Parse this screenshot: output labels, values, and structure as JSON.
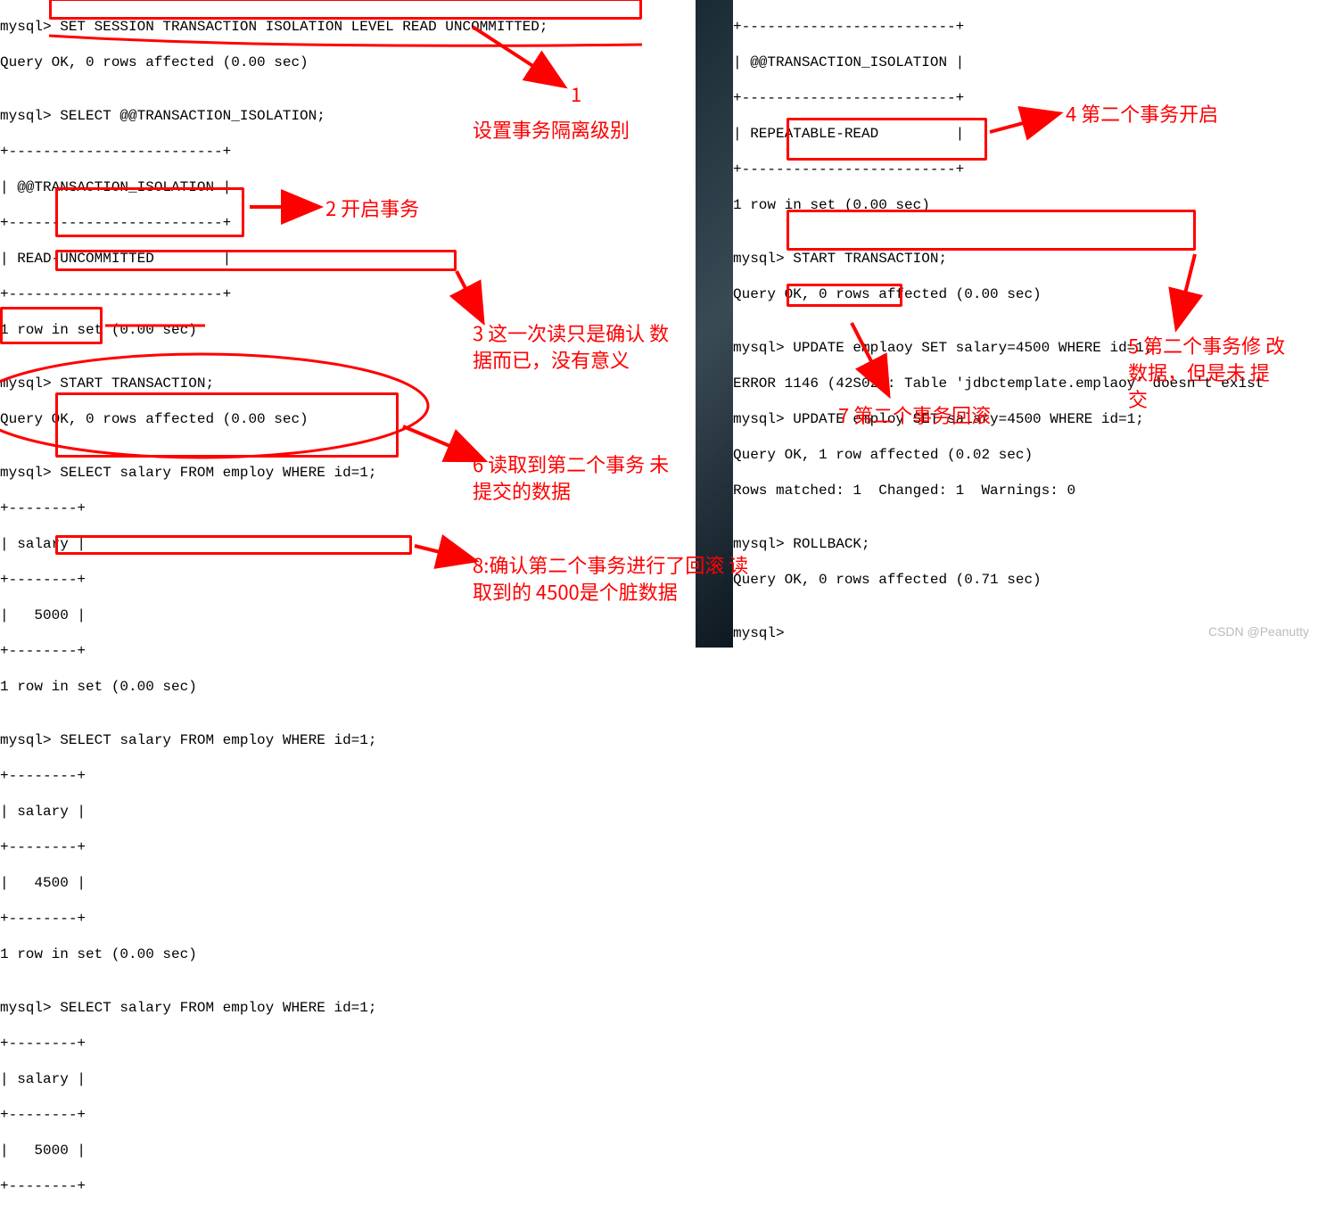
{
  "left_terminal": {
    "lines": [
      "mysql> SET SESSION TRANSACTION ISOLATION LEVEL READ UNCOMMITTED;",
      "Query OK, 0 rows affected (0.00 sec)",
      "",
      "mysql> SELECT @@TRANSACTION_ISOLATION;",
      "+-------------------------+",
      "| @@TRANSACTION_ISOLATION |",
      "+-------------------------+",
      "| READ-UNCOMMITTED        |",
      "+-------------------------+",
      "1 row in set (0.00 sec)",
      "",
      "mysql> START TRANSACTION;",
      "Query OK, 0 rows affected (0.00 sec)",
      "",
      "mysql> SELECT salary FROM employ WHERE id=1;",
      "+--------+",
      "| salary |",
      "+--------+",
      "|   5000 |",
      "+--------+",
      "1 row in set (0.00 sec)",
      "",
      "mysql> SELECT salary FROM employ WHERE id=1;",
      "+--------+",
      "| salary |",
      "+--------+",
      "|   4500 |",
      "+--------+",
      "1 row in set (0.00 sec)",
      "",
      "mysql> SELECT salary FROM employ WHERE id=1;",
      "+--------+",
      "| salary |",
      "+--------+",
      "|   5000 |",
      "+--------+"
    ]
  },
  "right_terminal": {
    "lines": [
      "+-------------------------+",
      "| @@TRANSACTION_ISOLATION |",
      "+-------------------------+",
      "| REPEATABLE-READ         |",
      "+-------------------------+",
      "1 row in set (0.00 sec)",
      "",
      "mysql> START TRANSACTION;",
      "Query OK, 0 rows affected (0.00 sec)",
      "",
      "mysql> UPDATE emplaoy SET salary=4500 WHERE id=1;",
      "ERROR 1146 (42S02): Table 'jdbctemplate.emplaoy' doesn't exist",
      "mysql> UPDATE employ SET salary=4500 WHERE id=1;",
      "Query OK, 1 row affected (0.02 sec)",
      "Rows matched: 1  Changed: 1  Warnings: 0",
      "",
      "mysql> ROLLBACK;",
      "Query OK, 0 rows affected (0.71 sec)",
      "",
      "mysql>"
    ]
  },
  "annotations": {
    "a1_num": "1",
    "a1": "设置事务隔离级别",
    "a2": "2 开启事务",
    "a3": "3 这一次读只是确认\n数据而已，没有意义",
    "a4": "4 第二个事务开启",
    "a5": "5 第二个事务修\n改数据，但是未\n提交",
    "a6": "6 读取到第二个事务\n未提交的数据",
    "a7": "7 第二个事务回滚",
    "a8": "8:确认第二个事务进行了回滚\n读取到的 4500是个脏数据"
  },
  "watermark": "CSDN @Peanutty"
}
